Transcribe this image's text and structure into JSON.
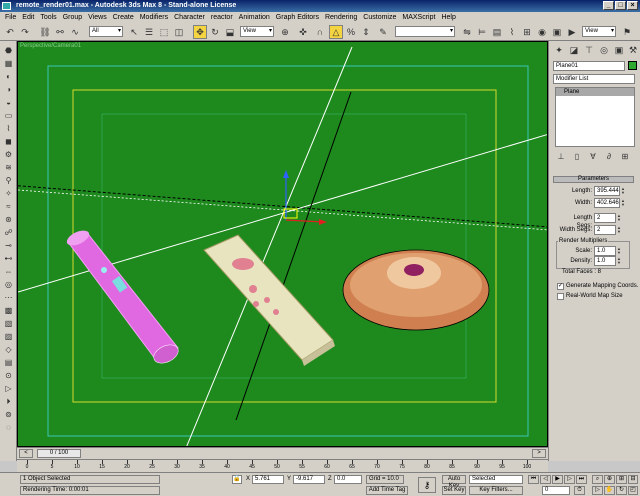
{
  "window": {
    "title": "remote_render01.max - Autodesk 3ds Max 8  - Stand-alone License"
  },
  "menu": [
    "File",
    "Edit",
    "Tools",
    "Group",
    "Views",
    "Create",
    "Modifiers",
    "Character",
    "reactor",
    "Animation",
    "Graph Editors",
    "Rendering",
    "Customize",
    "MAXScript",
    "Help"
  ],
  "toolbar": {
    "filter_value": "All",
    "refcoord_value": "View",
    "refcoord2_value": "View",
    "selset_value": "",
    "right_value": "View"
  },
  "viewport": {
    "label": "Perspective/Camera01"
  },
  "command_panel": {
    "object_name": "Plane01",
    "object_color": "#2ea82e",
    "modifier_list": "Modifier List",
    "stack_item": "Plane",
    "rollout_title": "Parameters",
    "length_label": "Length:",
    "length_value": "395.444",
    "width_label": "Width:",
    "width_value": "402.646",
    "length_segs_label": "Length Segs:",
    "length_segs_value": "2",
    "width_segs_label": "Width Segs:",
    "width_segs_value": "2",
    "render_mult_label": "Render Multipliers",
    "scale_label": "Scale:",
    "scale_value": "1.0",
    "density_label": "Density:",
    "density_value": "1.0",
    "total_faces": "Total Faces : 8",
    "gen_mapping": "Generate Mapping Coords.",
    "gen_mapping_checked": true,
    "realworld": "Real-World Map Size",
    "realworld_checked": false
  },
  "time": {
    "slider": "0 / 100",
    "ticks": [
      "0",
      "5",
      "10",
      "15",
      "20",
      "25",
      "30",
      "35",
      "40",
      "45",
      "50",
      "55",
      "60",
      "65",
      "70",
      "75",
      "80",
      "85",
      "90",
      "95",
      "100"
    ]
  },
  "status": {
    "selection": "1 Object Selected",
    "prompt": "Rendering Time: 0:00:01",
    "x": "5.761",
    "y": "-9.617",
    "z": "0.0",
    "x_label": "X",
    "y_label": "Y",
    "z_label": "Z",
    "grid": "Grid = 10.0",
    "add_time_tag": "Add Time Tag",
    "auto_key": "Auto Key",
    "set_key": "Set Key",
    "key_mode": "Selected",
    "key_filters": "Key Filters...",
    "frame": "0"
  }
}
